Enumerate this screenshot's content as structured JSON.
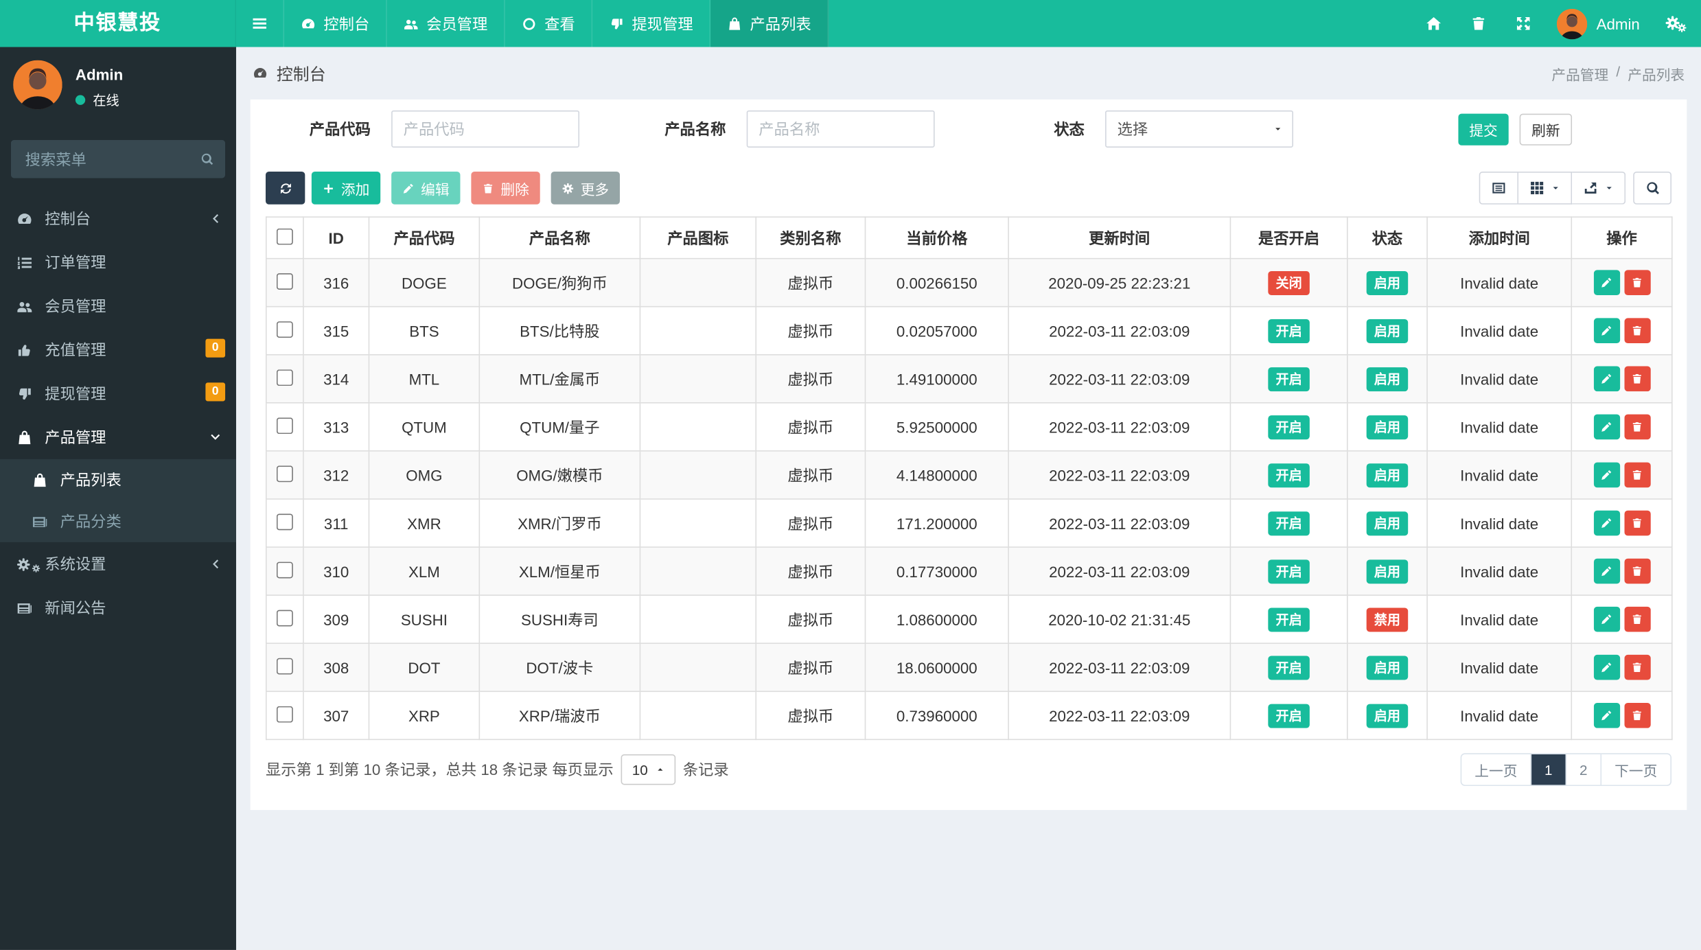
{
  "brand": {
    "title": "中银慧投"
  },
  "navbar": {
    "items": [
      {
        "label": "控制台"
      },
      {
        "label": "会员管理"
      },
      {
        "label": "查看"
      },
      {
        "label": "提现管理"
      },
      {
        "label": "产品列表"
      }
    ],
    "user_name": "Admin"
  },
  "sidebar": {
    "user_name": "Admin",
    "user_status": "在线",
    "search_placeholder": "搜索菜单",
    "menu": [
      {
        "label": "控制台"
      },
      {
        "label": "订单管理"
      },
      {
        "label": "会员管理"
      },
      {
        "label": "充值管理",
        "badge": "0"
      },
      {
        "label": "提现管理",
        "badge": "0"
      },
      {
        "label": "产品管理"
      },
      {
        "label": "系统设置"
      },
      {
        "label": "新闻公告"
      }
    ],
    "submenu": [
      {
        "label": "产品列表"
      },
      {
        "label": "产品分类"
      }
    ]
  },
  "breadcrumb": {
    "section": "控制台",
    "parent": "产品管理",
    "separator": "/",
    "current": "产品列表"
  },
  "filters": {
    "code_label": "产品代码",
    "code_placeholder": "产品代码",
    "name_label": "产品名称",
    "name_placeholder": "产品名称",
    "status_label": "状态",
    "status_value": "选择",
    "submit_label": "提交",
    "refresh_label": "刷新"
  },
  "toolbar": {
    "add_label": "添加",
    "edit_label": "编辑",
    "delete_label": "删除",
    "more_label": "更多"
  },
  "table": {
    "columns": [
      "",
      "ID",
      "产品代码",
      "产品名称",
      "产品图标",
      "类别名称",
      "当前价格",
      "更新时间",
      "是否开启",
      "状态",
      "添加时间",
      "操作"
    ],
    "rows": [
      {
        "id": "316",
        "code": "DOGE",
        "name": "DOGE/狗狗币",
        "category": "虚拟币",
        "price": "0.00266150",
        "updated": "2020-09-25 22:23:21",
        "open": "关闭",
        "open_on": false,
        "status": "启用",
        "status_on": true,
        "added": "Invalid date"
      },
      {
        "id": "315",
        "code": "BTS",
        "name": "BTS/比特股",
        "category": "虚拟币",
        "price": "0.02057000",
        "updated": "2022-03-11 22:03:09",
        "open": "开启",
        "open_on": true,
        "status": "启用",
        "status_on": true,
        "added": "Invalid date"
      },
      {
        "id": "314",
        "code": "MTL",
        "name": "MTL/金属币",
        "category": "虚拟币",
        "price": "1.49100000",
        "updated": "2022-03-11 22:03:09",
        "open": "开启",
        "open_on": true,
        "status": "启用",
        "status_on": true,
        "added": "Invalid date"
      },
      {
        "id": "313",
        "code": "QTUM",
        "name": "QTUM/量子",
        "category": "虚拟币",
        "price": "5.92500000",
        "updated": "2022-03-11 22:03:09",
        "open": "开启",
        "open_on": true,
        "status": "启用",
        "status_on": true,
        "added": "Invalid date"
      },
      {
        "id": "312",
        "code": "OMG",
        "name": "OMG/嫩模币",
        "category": "虚拟币",
        "price": "4.14800000",
        "updated": "2022-03-11 22:03:09",
        "open": "开启",
        "open_on": true,
        "status": "启用",
        "status_on": true,
        "added": "Invalid date"
      },
      {
        "id": "311",
        "code": "XMR",
        "name": "XMR/门罗币",
        "category": "虚拟币",
        "price": "171.200000",
        "updated": "2022-03-11 22:03:09",
        "open": "开启",
        "open_on": true,
        "status": "启用",
        "status_on": true,
        "added": "Invalid date"
      },
      {
        "id": "310",
        "code": "XLM",
        "name": "XLM/恒星币",
        "category": "虚拟币",
        "price": "0.17730000",
        "updated": "2022-03-11 22:03:09",
        "open": "开启",
        "open_on": true,
        "status": "启用",
        "status_on": true,
        "added": "Invalid date"
      },
      {
        "id": "309",
        "code": "SUSHI",
        "name": "SUSHI寿司",
        "category": "虚拟币",
        "price": "1.08600000",
        "updated": "2020-10-02 21:31:45",
        "open": "开启",
        "open_on": true,
        "status": "禁用",
        "status_on": false,
        "added": "Invalid date"
      },
      {
        "id": "308",
        "code": "DOT",
        "name": "DOT/波卡",
        "category": "虚拟币",
        "price": "18.0600000",
        "updated": "2022-03-11 22:03:09",
        "open": "开启",
        "open_on": true,
        "status": "启用",
        "status_on": true,
        "added": "Invalid date"
      },
      {
        "id": "307",
        "code": "XRP",
        "name": "XRP/瑞波币",
        "category": "虚拟币",
        "price": "0.73960000",
        "updated": "2022-03-11 22:03:09",
        "open": "开启",
        "open_on": true,
        "status": "启用",
        "status_on": true,
        "added": "Invalid date"
      }
    ]
  },
  "footer": {
    "summary_prefix": "显示第 1 到第 10 条记录，总共 18 条记录 每页显示",
    "page_size": "10",
    "summary_suffix": "条记录",
    "prev_label": "上一页",
    "pages": [
      "1",
      "2"
    ],
    "active_page": "1",
    "next_label": "下一页"
  },
  "colors": {
    "navbar": "#18bc9c",
    "navbar_active": "#15a589",
    "sidebar": "#222d32",
    "submenu": "#2c3b41",
    "badge_on": "#18bc9c",
    "badge_off": "#e74c3c",
    "badge_count": "#f39c12",
    "dark_button": "#2c3e50",
    "content_bg": "#ecf0f5"
  }
}
